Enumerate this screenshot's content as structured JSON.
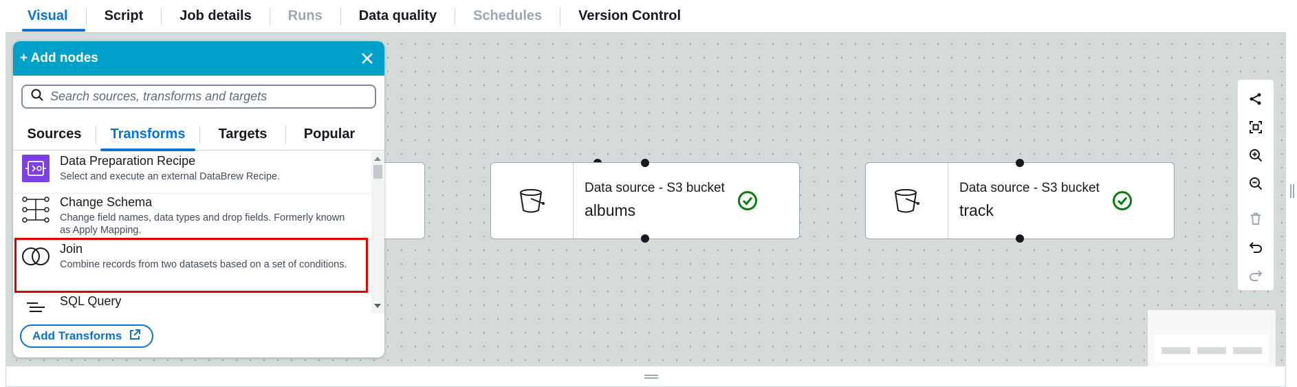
{
  "tabs": [
    {
      "label": "Visual",
      "state": "active"
    },
    {
      "label": "Script",
      "state": "normal"
    },
    {
      "label": "Job details",
      "state": "normal"
    },
    {
      "label": "Runs",
      "state": "disabled"
    },
    {
      "label": "Data quality",
      "state": "normal"
    },
    {
      "label": "Schedules",
      "state": "disabled"
    },
    {
      "label": "Version Control",
      "state": "normal"
    }
  ],
  "panel": {
    "title": "+ Add nodes",
    "search_placeholder": "Search sources, transforms and targets",
    "tabs": [
      "Sources",
      "Transforms",
      "Targets",
      "Popular"
    ],
    "active_tab": "Transforms",
    "items": [
      {
        "name": "Data Preparation Recipe",
        "description": "Select and execute an external DataBrew Recipe.",
        "icon": "databrew-recipe-icon"
      },
      {
        "name": "Change Schema",
        "description": "Change field names, data types and drop fields. Formerly known as Apply Mapping.",
        "icon": "change-schema-icon"
      },
      {
        "name": "Join",
        "description": "Combine records from two datasets based on a set of conditions.",
        "icon": "join-icon"
      },
      {
        "name": "SQL Query",
        "description": "",
        "icon": "sql-query-icon"
      }
    ],
    "add_button_label": "Add Transforms"
  },
  "nodes": [
    {
      "type": "Data source - S3 bucket",
      "name": "albums",
      "status": "valid"
    },
    {
      "type": "Data source - S3 bucket",
      "name": "track",
      "status": "valid"
    }
  ],
  "colors": {
    "accent": "#0972d3",
    "header": "#00a1c9",
    "success": "#037f0c",
    "highlight": "#e00000",
    "canvas": "#d5dbdb"
  }
}
